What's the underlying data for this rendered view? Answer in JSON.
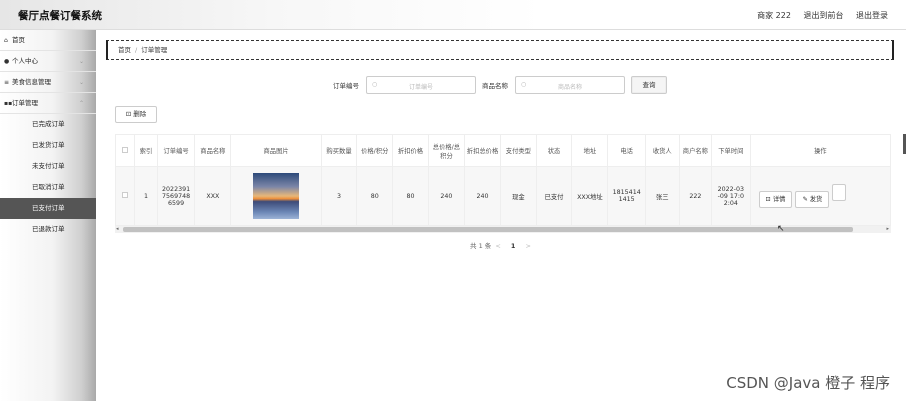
{
  "app": {
    "title": "餐厅点餐订餐系统"
  },
  "header": {
    "user": "商家 222",
    "to_front": "退出到前台",
    "logout": "退出登录"
  },
  "sidebar": {
    "items": [
      {
        "label": "首页",
        "icon": "home-icon"
      },
      {
        "label": "个人中心",
        "icon": "user-icon"
      },
      {
        "label": "美食信息管理",
        "icon": "list-icon"
      },
      {
        "label": "订单管理",
        "icon": "grid-icon"
      }
    ],
    "sub_items": [
      "已完成订单",
      "已发货订单",
      "未支付订单",
      "已取消订单",
      "已支付订单",
      "已退款订单"
    ],
    "active_sub": "已支付订单"
  },
  "breadcrumb": {
    "home": "首页",
    "sep": "/",
    "current": "订单管理"
  },
  "search": {
    "order_no_label": "订单编号",
    "order_no_placeholder": "订单编号",
    "product_label": "商品名称",
    "product_placeholder": "商品名称",
    "button": "查询"
  },
  "toolbar": {
    "delete_label": "删除"
  },
  "table": {
    "headers": [
      "",
      "索引",
      "订单编号",
      "商品名称",
      "商品图片",
      "购买数量",
      "价格/积分",
      "折扣价格",
      "总价格/总积分",
      "折扣总价格",
      "支付类型",
      "状态",
      "地址",
      "电话",
      "收货人",
      "商户名称",
      "下单时间",
      "操作"
    ],
    "rows": [
      {
        "index": "1",
        "order_no": "2022391 7569748 6599",
        "product": "XXX",
        "qty": "3",
        "price": "80",
        "discount_price": "80",
        "total": "240",
        "discount_total": "240",
        "pay_type": "现金",
        "status": "已支付",
        "address": "XXX地址",
        "phone": "1815414 1415",
        "receiver": "张三",
        "merchant": "222",
        "time": "2022-03 -09 17:0 2:04",
        "ops": {
          "detail": "详情",
          "ship": "发货"
        }
      }
    ]
  },
  "pagination": {
    "total_text": "共 1 条",
    "current": "1",
    "prev": "<",
    "next": ">"
  },
  "watermark": "CSDN @Java 橙子 程序"
}
